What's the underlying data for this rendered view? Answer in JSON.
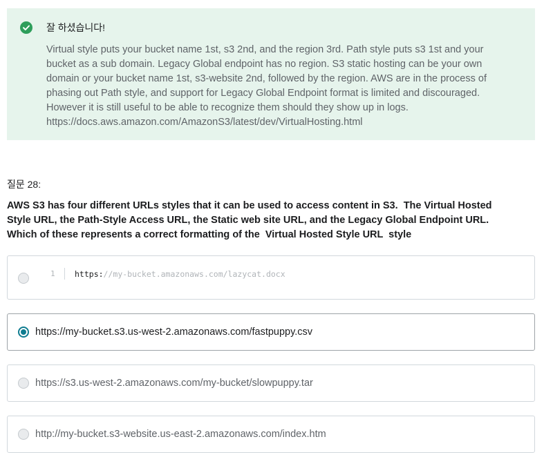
{
  "feedback": {
    "title": "잘 하셨습니다!",
    "status_color": "#2e9e5b",
    "icon": "check-circle-icon",
    "lines": [
      "Virtual style puts your bucket name 1st, s3 2nd, and the region 3rd. Path style puts s3 1st and your",
      "bucket as a sub domain. Legacy Global endpoint has no region. S3 static hosting can be your own",
      "domain or your bucket name 1st, s3-website 2nd, followed by the region. AWS are in the process of",
      "phasing out Path style, and support for Legacy Global Endpoint format is limited and discouraged.",
      "However it is still useful to be able to recognize them should they show up in logs.",
      "https://docs.aws.amazon.com/AmazonS3/latest/dev/VirtualHosting.html"
    ]
  },
  "question": {
    "label": "질문 28:",
    "lines": [
      "AWS S3 has four different URLs styles that it can be used to access content in S3.  The Virtual Hosted",
      "Style URL, the Path-Style Access URL, the Static web site URL, and the Legacy Global Endpoint URL.",
      "Which of these represents a correct formatting of the  Virtual Hosted Style URL  style"
    ]
  },
  "options": [
    {
      "type": "code",
      "line_number": "1",
      "scheme": "https:",
      "rest": "//my-bucket.amazonaws.com/lazycat.docx",
      "selected": false
    },
    {
      "type": "text",
      "text": "https://my-bucket.s3.us-west-2.amazonaws.com/fastpuppy.csv",
      "selected": true
    },
    {
      "type": "text",
      "text": "https://s3.us-west-2.amazonaws.com/my-bucket/slowpuppy.tar",
      "selected": false
    },
    {
      "type": "text",
      "text": "http://my-bucket.s3-website.us-east-2.amazonaws.com/index.htm",
      "selected": false
    }
  ],
  "colors": {
    "feedback_bg": "#e6f4ec",
    "accent": "#0f7c90",
    "border": "#d1d7dc",
    "muted_text": "#5f6368"
  }
}
